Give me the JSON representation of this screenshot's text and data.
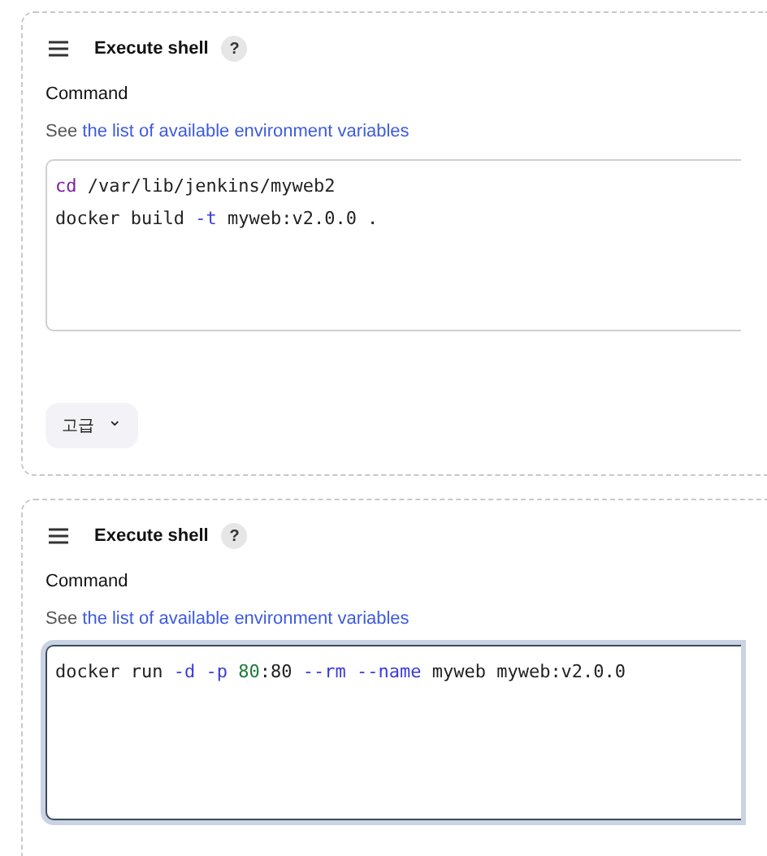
{
  "steps": [
    {
      "title": "Execute shell",
      "help": "?",
      "command_label": "Command",
      "hint_prefix": "See",
      "hint_link": "the list of available environment variables",
      "focused": false,
      "code": [
        [
          {
            "text": "cd",
            "kind": "keyword"
          },
          {
            "text": " /var/lib/jenkins/myweb2",
            "kind": "plain"
          }
        ],
        [
          {
            "text": "docker build ",
            "kind": "plain"
          },
          {
            "text": "-t",
            "kind": "flag"
          },
          {
            "text": " myweb:v2.0.0 .",
            "kind": "plain"
          }
        ]
      ],
      "advanced": {
        "label": "고급",
        "caret": "⌄"
      }
    },
    {
      "title": "Execute shell",
      "help": "?",
      "command_label": "Command",
      "hint_prefix": "See",
      "hint_link": "the list of available environment variables",
      "focused": true,
      "code": [
        [
          {
            "text": "docker run ",
            "kind": "plain"
          },
          {
            "text": "-d -p ",
            "kind": "flag"
          },
          {
            "text": "80",
            "kind": "number"
          },
          {
            "text": ":80 ",
            "kind": "plain"
          },
          {
            "text": "--rm --name",
            "kind": "flag"
          },
          {
            "text": " myweb myweb:v2.0.0",
            "kind": "plain"
          }
        ]
      ]
    }
  ]
}
